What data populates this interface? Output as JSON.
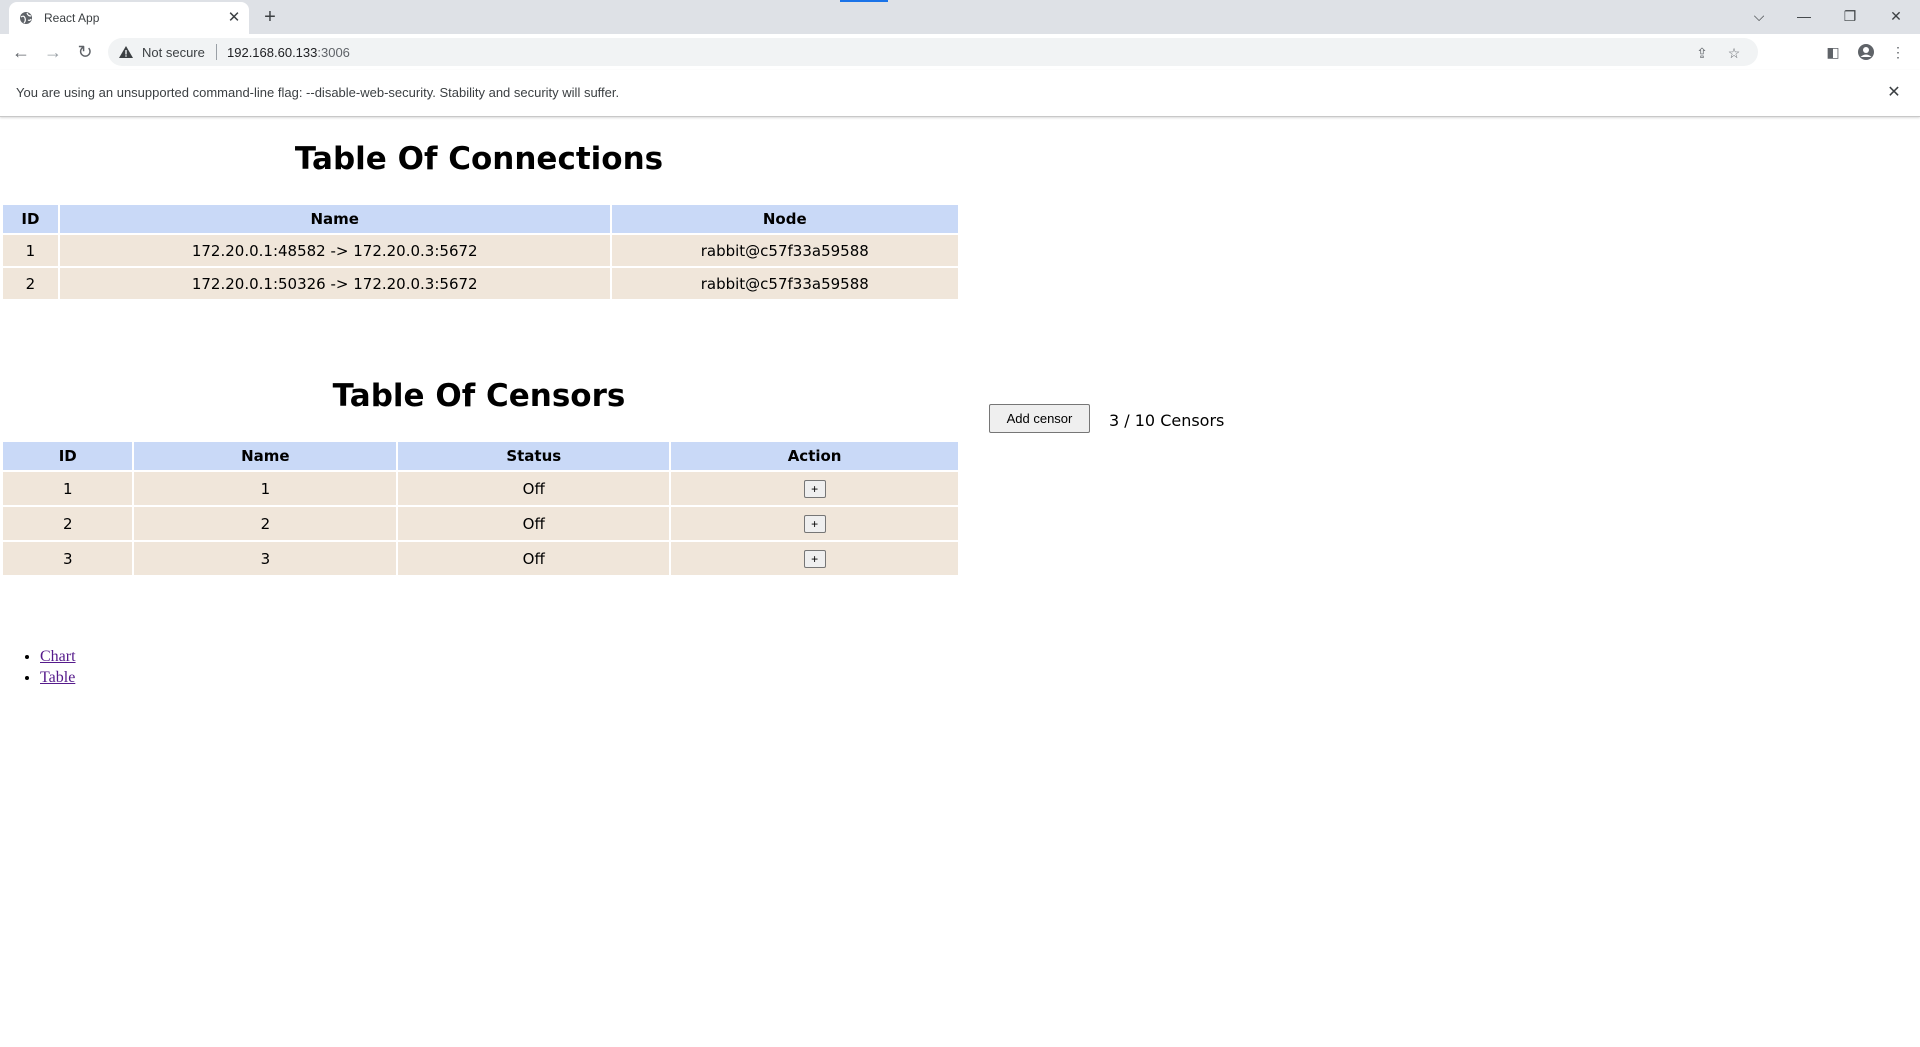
{
  "browser": {
    "tab_title": "React App",
    "new_tab_symbol": "+",
    "not_secure_label": "Not secure",
    "url_host": "192.168.60.133",
    "url_port": ":3006"
  },
  "infobar": {
    "message": "You are using an unsupported command-line flag: --disable-web-security. Stability and security will suffer."
  },
  "connections": {
    "title": "Table Of Connections",
    "headers": [
      "ID",
      "Name",
      "Node"
    ],
    "rows": [
      {
        "id": "1",
        "name": "172.20.0.1:48582 -> 172.20.0.3:5672",
        "node": "rabbit@c57f33a59588"
      },
      {
        "id": "2",
        "name": "172.20.0.1:50326 -> 172.20.0.3:5672",
        "node": "rabbit@c57f33a59588"
      }
    ]
  },
  "censors": {
    "title": "Table Of Censors",
    "headers": [
      "ID",
      "Name",
      "Status",
      "Action"
    ],
    "rows": [
      {
        "id": "1",
        "name": "1",
        "status": "Off",
        "action": "+"
      },
      {
        "id": "2",
        "name": "2",
        "status": "Off",
        "action": "+"
      },
      {
        "id": "3",
        "name": "3",
        "status": "Off",
        "action": "+"
      }
    ],
    "add_button_label": "Add censor",
    "counter_text": "3 / 10 Censors"
  },
  "nav_links": [
    {
      "label": "Chart"
    },
    {
      "label": "Table"
    }
  ],
  "colors": {
    "header_bg": "#c9d9f7",
    "row_bg": "#f0e6da",
    "visited_link": "#551a8b",
    "tab_accent": "#1a73e8"
  }
}
